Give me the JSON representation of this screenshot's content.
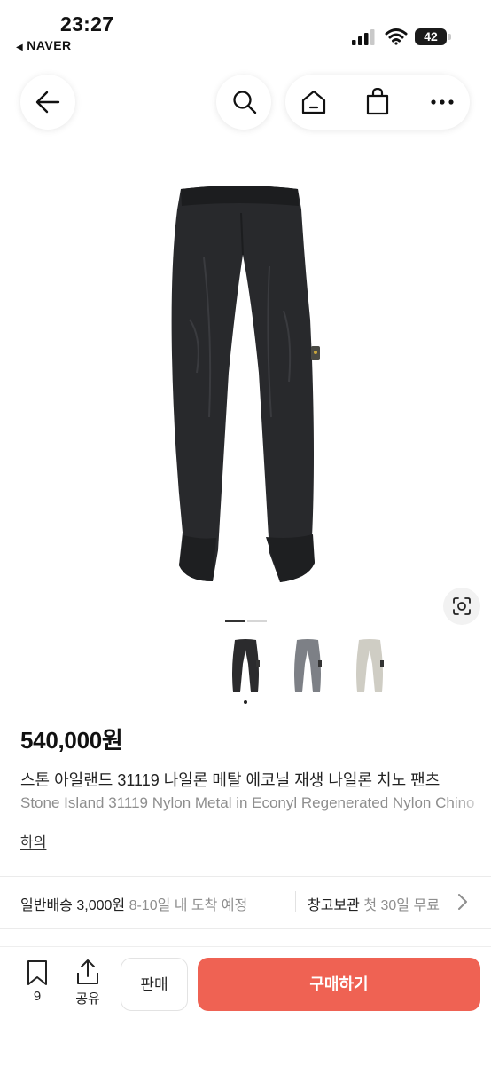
{
  "status_bar": {
    "time": "23:27",
    "back_app": "NAVER",
    "battery": "42"
  },
  "nav": {
    "back_icon": "arrow-left-icon",
    "search_icon": "search-icon",
    "home_icon": "home-icon",
    "bag_icon": "shopping-bag-icon",
    "more_icon": "more-horizontal-icon"
  },
  "gallery": {
    "image_count": 2,
    "active_index": 0,
    "thumbnails": [
      {
        "color_name": "black",
        "color": "#2b2b2d",
        "selected": true
      },
      {
        "color_name": "grey",
        "color": "#7d8086",
        "selected": false
      },
      {
        "color_name": "beige",
        "color": "#cfcdc4",
        "selected": false
      }
    ]
  },
  "product": {
    "price": "540,000원",
    "title_ko": "스톤 아일랜드 31119 나일론 메탈 에코닐 재생 나일론 치노 팬츠",
    "title_en": "Stone Island 31119 Nylon Metal in Econyl Regenerated Nylon Chino",
    "category": "하의"
  },
  "shipping": {
    "label": "일반배송",
    "fee": "3,000원",
    "eta": "8-10일 내 도착 예정",
    "storage_label": "창고보관",
    "storage_note": "첫 30일 무료"
  },
  "bottom_bar": {
    "bookmark_count": "9",
    "share_label": "공유",
    "sell_label": "판매",
    "buy_label": "구매하기"
  },
  "colors": {
    "accent": "#ef6253",
    "text": "#222222",
    "muted": "#8e8e8e"
  }
}
